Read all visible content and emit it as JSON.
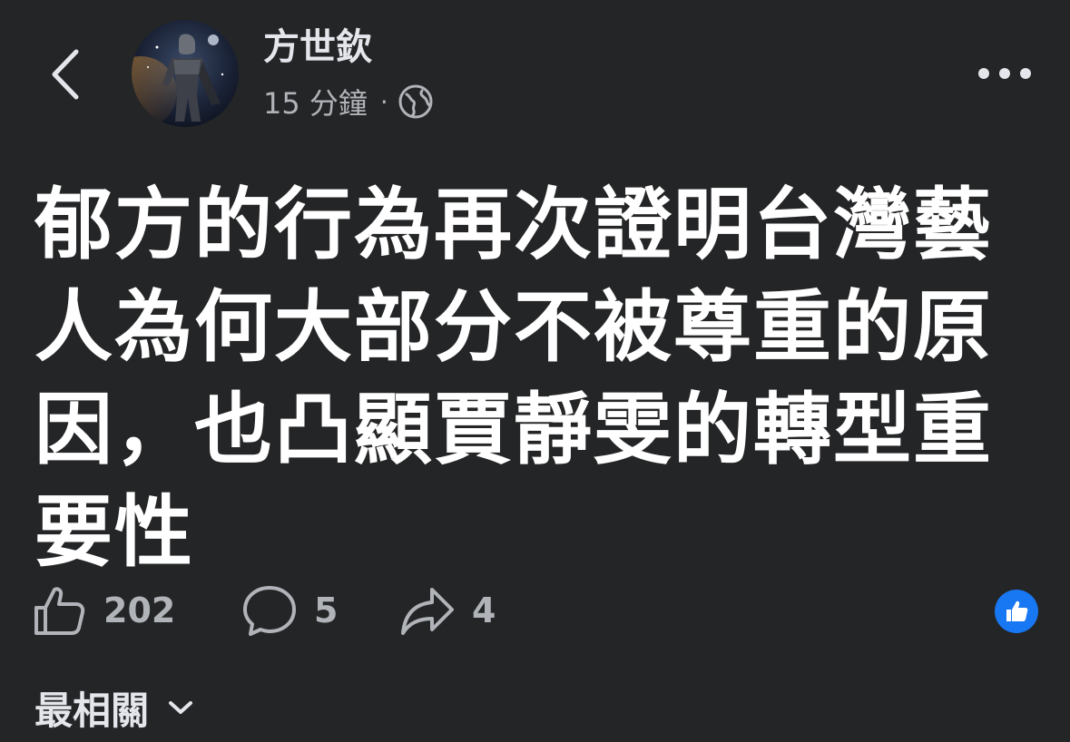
{
  "header": {
    "author_name": "方世欽",
    "timestamp": "15 分鐘",
    "separator": "·",
    "privacy_icon": "globe-icon",
    "back_icon": "chevron-left-icon",
    "more_icon": "more-horizontal-icon"
  },
  "post": {
    "text": "郁方的行為再次證明台灣藝人為何大部分不被尊重的原因，也凸顯賈靜雯的轉型重要性"
  },
  "actions": {
    "like_icon": "thumbs-up-icon",
    "like_count": "202",
    "comment_icon": "comment-icon",
    "comment_count": "5",
    "share_icon": "share-icon",
    "share_count": "4",
    "reaction_badge_icon": "like-reaction-icon"
  },
  "sort": {
    "label": "最相關",
    "icon": "chevron-down-icon"
  },
  "colors": {
    "background": "#242526",
    "primary_text": "#e4e6eb",
    "secondary_text": "#b0b3b8",
    "like_blue": "#1877f2"
  }
}
